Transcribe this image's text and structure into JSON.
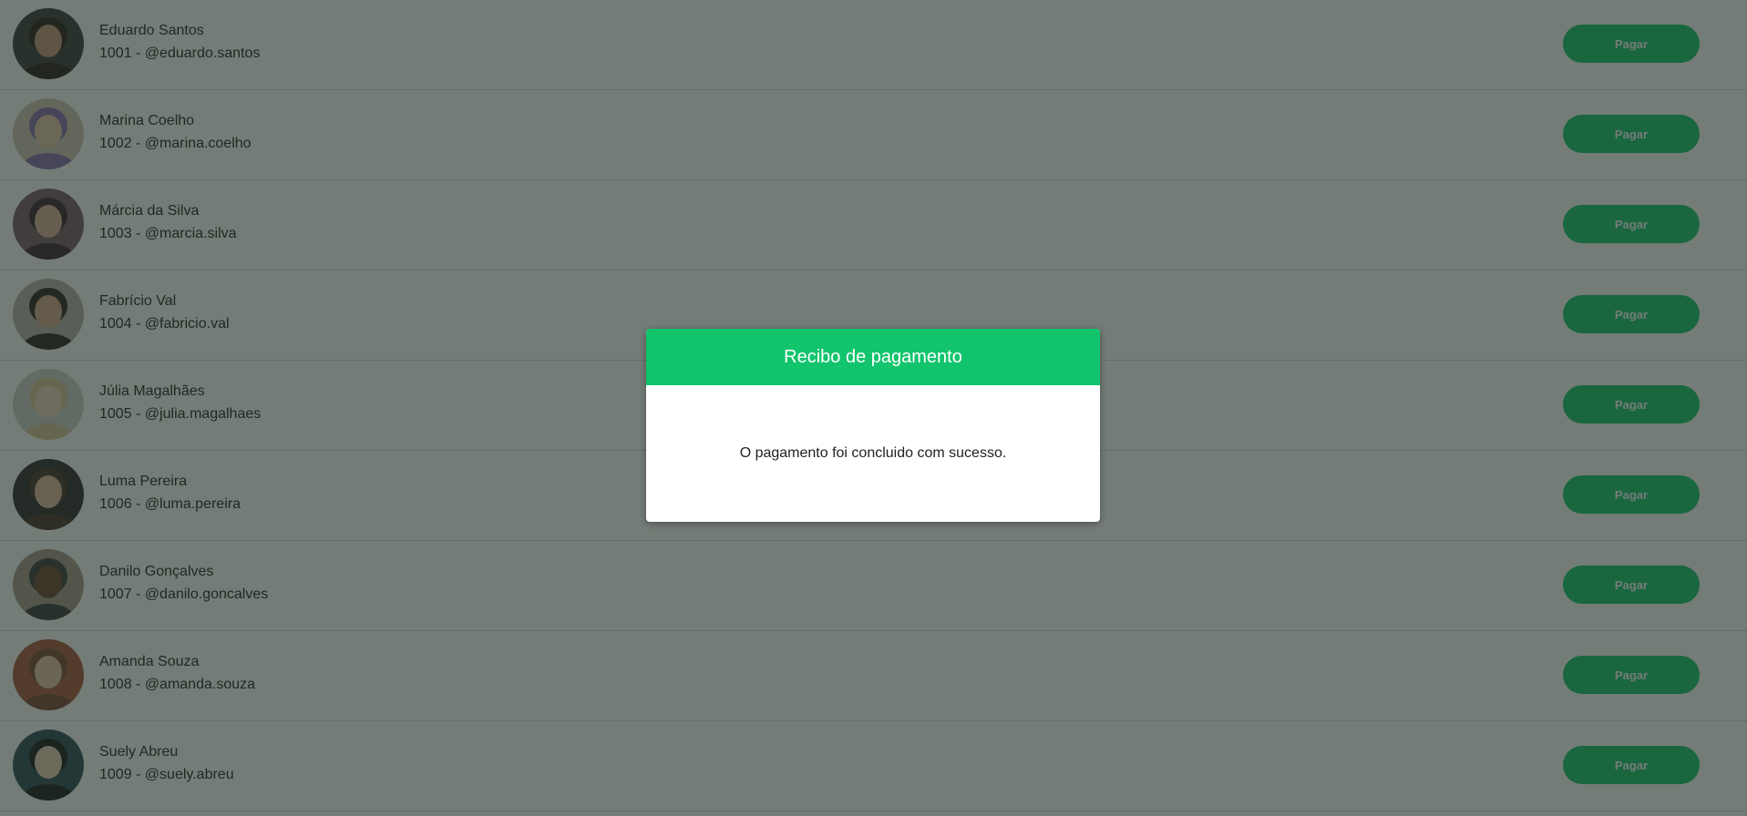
{
  "colors": {
    "accent": "#12c46c",
    "overlay": "#1e2c24"
  },
  "users": [
    {
      "name": "Eduardo Santos",
      "handle": "1001 - @eduardo.santos",
      "pay_label": "Pagar"
    },
    {
      "name": "Marina Coelho",
      "handle": "1002 - @marina.coelho",
      "pay_label": "Pagar"
    },
    {
      "name": "Márcia da Silva",
      "handle": "1003 - @marcia.silva",
      "pay_label": "Pagar"
    },
    {
      "name": "Fabrício Val",
      "handle": "1004 - @fabricio.val",
      "pay_label": "Pagar"
    },
    {
      "name": "Júlia Magalhães",
      "handle": "1005 - @julia.magalhaes",
      "pay_label": "Pagar"
    },
    {
      "name": "Luma Pereira",
      "handle": "1006 - @luma.pereira",
      "pay_label": "Pagar"
    },
    {
      "name": "Danilo Gonçalves",
      "handle": "1007 - @danilo.goncalves",
      "pay_label": "Pagar"
    },
    {
      "name": "Amanda Souza",
      "handle": "1008 - @amanda.souza",
      "pay_label": "Pagar"
    },
    {
      "name": "Suely Abreu",
      "handle": "1009 - @suely.abreu",
      "pay_label": "Pagar"
    }
  ],
  "modal": {
    "title": "Recibo de pagamento",
    "message": "O pagamento foi concluido com sucesso."
  }
}
